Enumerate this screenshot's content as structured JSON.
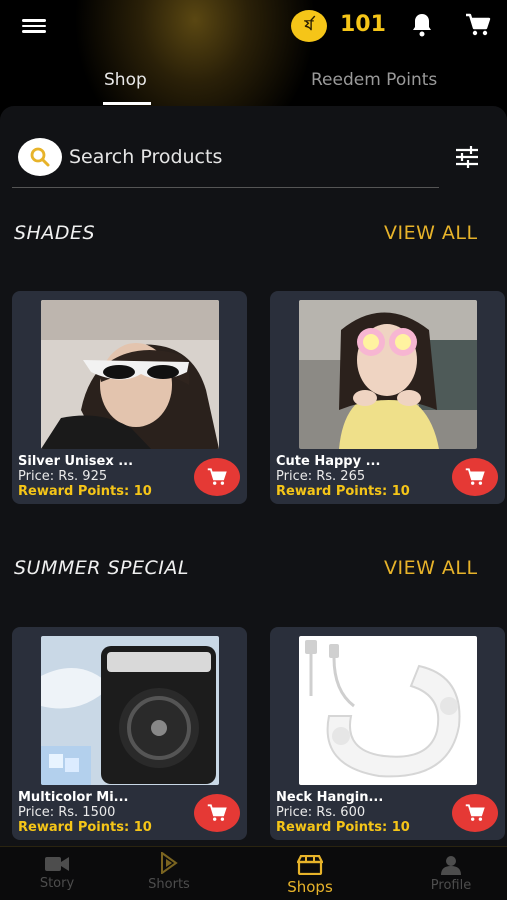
{
  "header": {
    "coin_label": "ৰ্য",
    "points": "101"
  },
  "tabs": [
    {
      "label": "Shop",
      "active": true
    },
    {
      "label": "Reedem Points",
      "active": false
    }
  ],
  "search": {
    "placeholder": "Search Products"
  },
  "sections": [
    {
      "title": "SHADES",
      "view_all": "VIEW ALL",
      "products": [
        {
          "name": "Silver Unisex ...",
          "price": "Price: Rs. 925",
          "reward": "Reward Points: 10"
        },
        {
          "name": "Cute Happy ...",
          "price": "Price: Rs. 265",
          "reward": "Reward Points: 10"
        }
      ]
    },
    {
      "title": "SUMMER SPECIAL",
      "view_all": "VIEW ALL",
      "products": [
        {
          "name": "Multicolor Mi...",
          "price": "Price: Rs. 1500",
          "reward": "Reward Points: 10"
        },
        {
          "name": "Neck Hangin...",
          "price": "Price: Rs. 600",
          "reward": "Reward Points: 10"
        }
      ]
    }
  ],
  "bottom_nav": [
    {
      "label": "Story",
      "icon": "video-camera-icon"
    },
    {
      "label": "Shorts",
      "icon": "shorts-icon"
    },
    {
      "label": "Shops",
      "icon": "shop-icon",
      "active": true
    },
    {
      "label": "Profile",
      "icon": "person-icon"
    }
  ],
  "colors": {
    "accent": "#e7b32a",
    "coin": "#f5c518",
    "cart_button": "#e53935",
    "card": "#2a2f3b",
    "panel": "#111215"
  }
}
